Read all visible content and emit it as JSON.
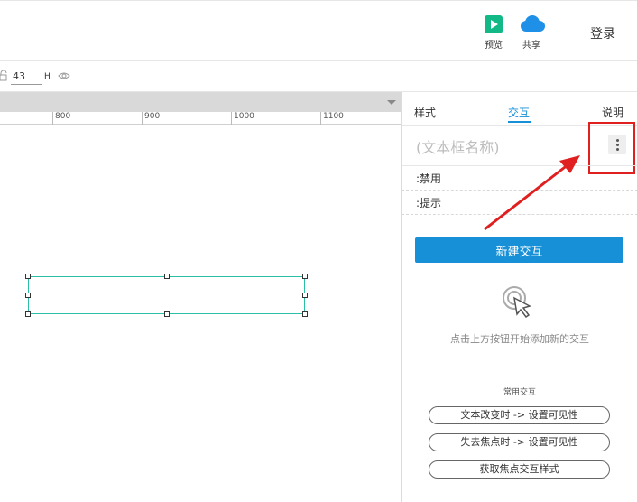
{
  "toolbar": {
    "preview_label": "预览",
    "share_label": "共享",
    "login_label": "登录"
  },
  "row2": {
    "height_value": "43",
    "height_unit": "H"
  },
  "ruler": {
    "ticks": [
      "800",
      "900",
      "1000",
      "1100"
    ]
  },
  "panel": {
    "tabs": [
      "样式",
      "交互",
      "说明"
    ],
    "active_tab": "交互",
    "widget_name_placeholder": "(文本框名称)",
    "options": [
      ":禁用",
      ":提示"
    ],
    "new_interaction_label": "新建交互",
    "hint_text": "点击上方按钮开始添加新的交互",
    "common_title": "常用交互",
    "common_items": [
      "文本改变时 -> 设置可见性",
      "失去焦点时 -> 设置可见性",
      "获取焦点交互样式"
    ]
  },
  "colors": {
    "accent": "#1890d8",
    "preview_icon": "#12b886",
    "share_icon": "#1e90e8",
    "selection_outline": "#2bbfa5",
    "annotation_red": "#e02020"
  },
  "icons": [
    "play-icon",
    "cloud-icon",
    "lock-icon",
    "eye-icon",
    "kebab-menu-icon",
    "pointer-click-icon",
    "chevron-down-icon"
  ]
}
